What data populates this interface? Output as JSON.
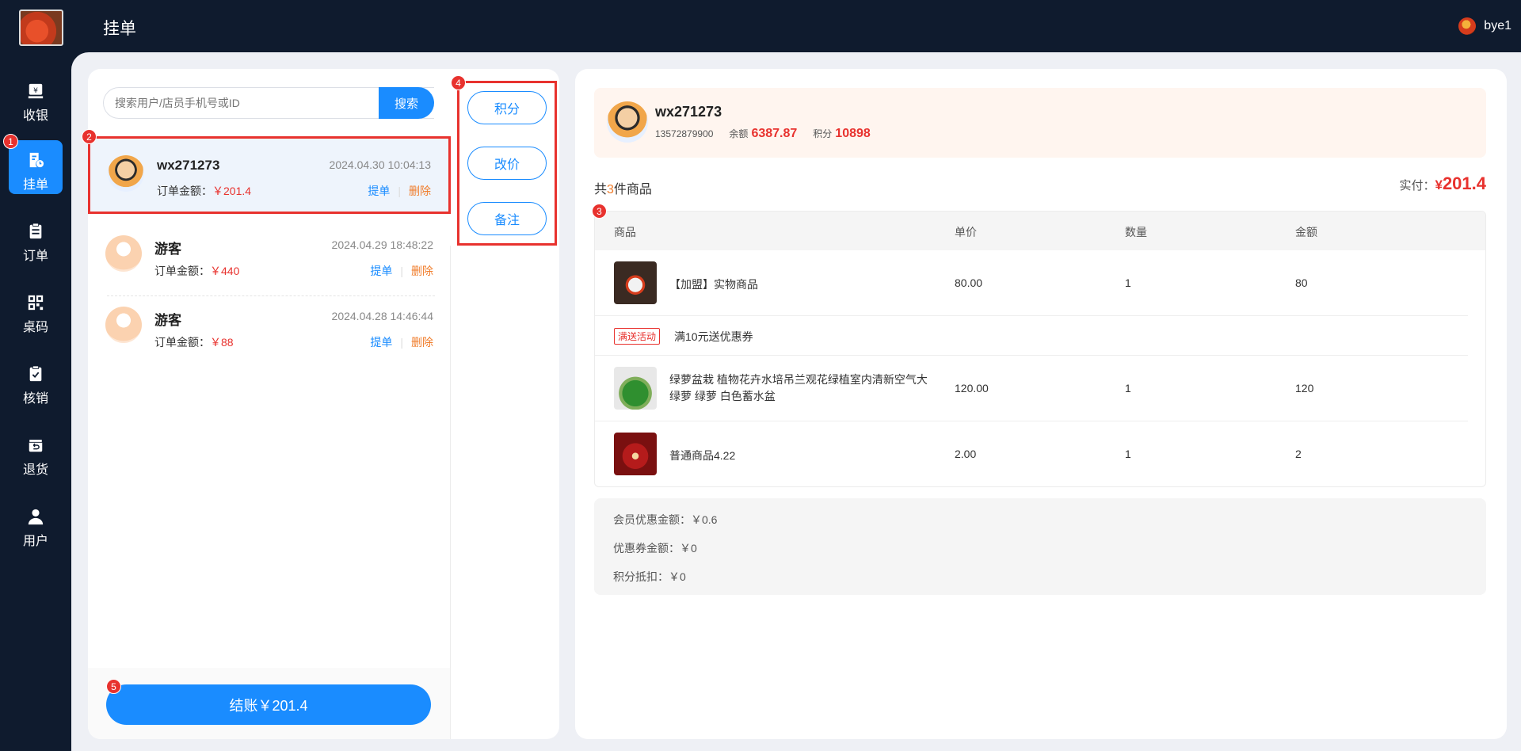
{
  "header": {
    "title": "挂单",
    "user_name": "bye1"
  },
  "sidebar": {
    "items": [
      {
        "label": "收银",
        "icon": "cashier-icon"
      },
      {
        "label": "挂单",
        "icon": "hang-order-icon",
        "active": true
      },
      {
        "label": "订单",
        "icon": "order-icon"
      },
      {
        "label": "桌码",
        "icon": "qr-code-icon"
      },
      {
        "label": "核销",
        "icon": "verify-icon"
      },
      {
        "label": "退货",
        "icon": "return-icon"
      },
      {
        "label": "用户",
        "icon": "user-icon"
      }
    ]
  },
  "badges": [
    "1",
    "2",
    "3",
    "4",
    "5"
  ],
  "search": {
    "placeholder": "搜索用户/店员手机号或ID",
    "button": "搜索"
  },
  "orders": [
    {
      "name": "wx271273",
      "time": "2024.04.30 10:04:13",
      "amount_label": "订单金额：",
      "amount": "￥201.4",
      "pick": "提单",
      "delete": "删除",
      "selected": true
    },
    {
      "name": "游客",
      "time": "2024.04.29 18:48:22",
      "amount_label": "订单金额：",
      "amount": "￥440",
      "pick": "提单",
      "delete": "删除"
    },
    {
      "name": "游客",
      "time": "2024.04.28 14:46:44",
      "amount_label": "订单金额：",
      "amount": "￥88",
      "pick": "提单",
      "delete": "删除"
    }
  ],
  "actions": {
    "points": "积分",
    "change_price": "改价",
    "note": "备注"
  },
  "checkout": {
    "label": "结账￥201.4"
  },
  "member": {
    "name": "wx271273",
    "phone": "13572879900",
    "balance_label": "余额",
    "balance": "6387.87",
    "points_label": "积分",
    "points": "10898"
  },
  "summary": {
    "prefix": "共",
    "count": "3",
    "suffix": "件商品",
    "paid_label": "实付：",
    "paid_yen": "¥",
    "paid_amount": "201.4"
  },
  "table": {
    "headers": [
      "商品",
      "单价",
      "数量",
      "金额"
    ],
    "rows": [
      {
        "name": "【加盟】实物商品",
        "price": "80.00",
        "qty": "1",
        "amount": "80"
      },
      {
        "name_line1": "绿萝盆栽 植物花卉水培吊兰观花绿植室内清新空气大",
        "name_line2": "绿萝 绿萝 白色蓄水盆",
        "price": "120.00",
        "qty": "1",
        "amount": "120"
      },
      {
        "name": "普通商品4.22",
        "price": "2.00",
        "qty": "1",
        "amount": "2"
      }
    ],
    "promo": {
      "tag": "满送活动",
      "text": "满10元送优惠券"
    }
  },
  "discounts": {
    "member": "会员优惠金额：￥0.6",
    "coupon": "优惠券金额：￥0",
    "points": "积分抵扣：￥0"
  },
  "colors": {
    "primary": "#1a8cff",
    "danger": "#e8322e",
    "dark": "#0f1b2e",
    "orange": "#f07c2a"
  }
}
